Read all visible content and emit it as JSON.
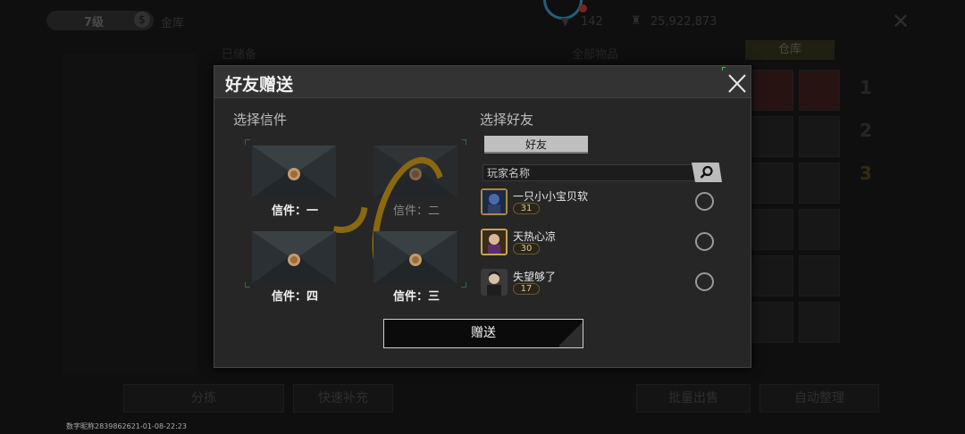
{
  "background": {
    "level": "7级",
    "gold_label": "金库",
    "coin_icon": "coin-icon",
    "energy_value": "142",
    "money_value": "25,922,873",
    "left_column_label": "已储备",
    "middle_column_label": "全部物品",
    "warehouse_tab": "仓库",
    "side_numbers": [
      "1",
      "2",
      "3"
    ],
    "bottom_buttons": [
      "分拣",
      "快速补充",
      "批量出售",
      "自动整理"
    ]
  },
  "footer_watermark": "数字昵称2839862621-01-08-22:23",
  "modal": {
    "title": "好友赠送",
    "close_icon": "close-icon",
    "letters_section_label": "选择信件",
    "letters": [
      {
        "name": "信件：一",
        "selected": true
      },
      {
        "name": "信件：二",
        "selected": false
      },
      {
        "name": "信件：四",
        "selected": true
      },
      {
        "name": "信件：三",
        "selected": true
      }
    ],
    "friends_section_label": "选择好友",
    "friend_tab_label": "好友",
    "search_placeholder": "玩家名称",
    "search_icon": "search-icon",
    "friends": [
      {
        "name": "一只小小宝贝软",
        "level": "31"
      },
      {
        "name": "天热心凉",
        "level": "30"
      },
      {
        "name": "失望够了",
        "level": "17"
      }
    ],
    "send_label": "赠送"
  },
  "colors": {
    "modal_bg": "#262626",
    "header_bg": "#333333",
    "accent_gold": "#a37a14",
    "corner_green": "#2f6a45"
  }
}
